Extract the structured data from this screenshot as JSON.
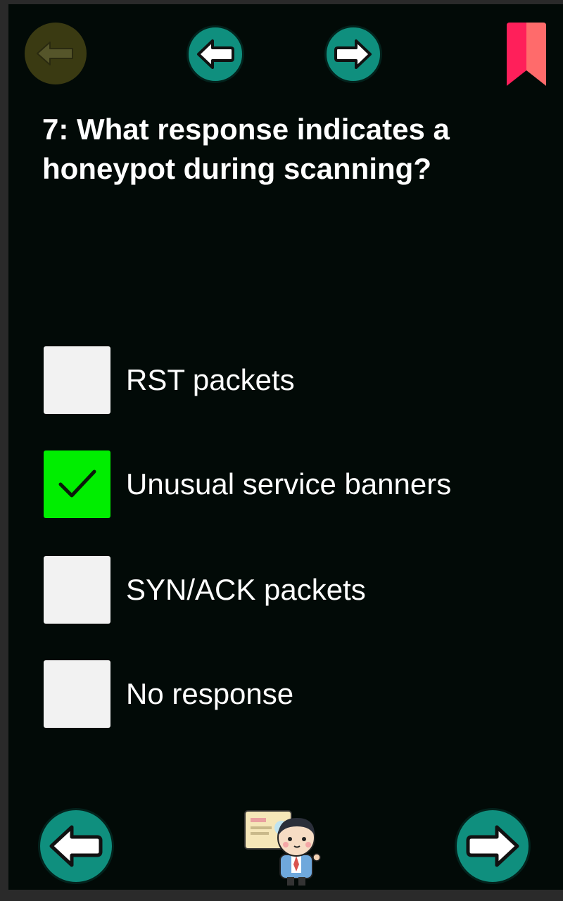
{
  "nav": {
    "back_icon": "back-arrow-icon",
    "prev_icon": "arrow-left-icon",
    "next_icon": "arrow-right-icon",
    "bookmark_icon": "bookmark-icon",
    "bookmark_color": "#ff2e6a",
    "button_color": "#0f8f7e"
  },
  "question": {
    "text": "7: What response indicates a honeypot during scanning?"
  },
  "options": [
    {
      "label": "RST packets",
      "checked": false
    },
    {
      "label": "Unusual service banners",
      "checked": true
    },
    {
      "label": "SYN/ACK packets",
      "checked": false
    },
    {
      "label": "No response",
      "checked": false
    }
  ],
  "colors": {
    "background": "#020a07",
    "checked": "#00ee00",
    "unchecked": "#f2f2f2"
  },
  "mascot_icon": "businessman-mascot-icon"
}
